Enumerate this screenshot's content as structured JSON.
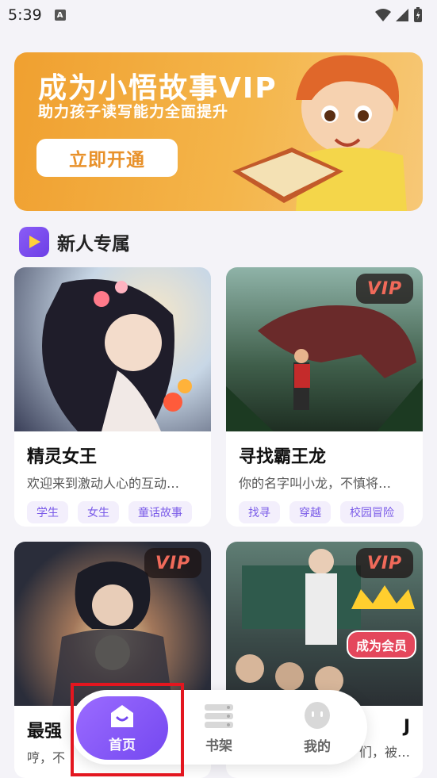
{
  "status_bar": {
    "time": "5:39",
    "app_icon_text": "A"
  },
  "banner": {
    "title": "成为小悟故事VIP",
    "subtitle": "助力孩子读写能力全面提升",
    "button_label": "立即开通"
  },
  "section": {
    "title": "新人专属"
  },
  "cards": [
    {
      "title": "精灵女王",
      "desc": "欢迎来到激动人心的互动…",
      "tags": [
        "学生",
        "女生",
        "童话故事"
      ],
      "vip": ""
    },
    {
      "title": "寻找霸王龙",
      "desc": "你的名字叫小龙，不慎将…",
      "tags": [
        "找寻",
        "穿越",
        "校园冒险"
      ],
      "vip": "VIP"
    },
    {
      "title": "最强",
      "desc": "哼，不",
      "tags": [],
      "vip": "VIP"
    },
    {
      "title": "J",
      "desc": "们，被…",
      "tags": [],
      "vip": "VIP",
      "member_badge": "成为会员"
    }
  ],
  "nav": {
    "home": "首页",
    "shelf": "书架",
    "mine": "我的"
  },
  "colors": {
    "accent": "#7448f0",
    "banner": "#f4b54a",
    "highlight": "#e3161f"
  }
}
